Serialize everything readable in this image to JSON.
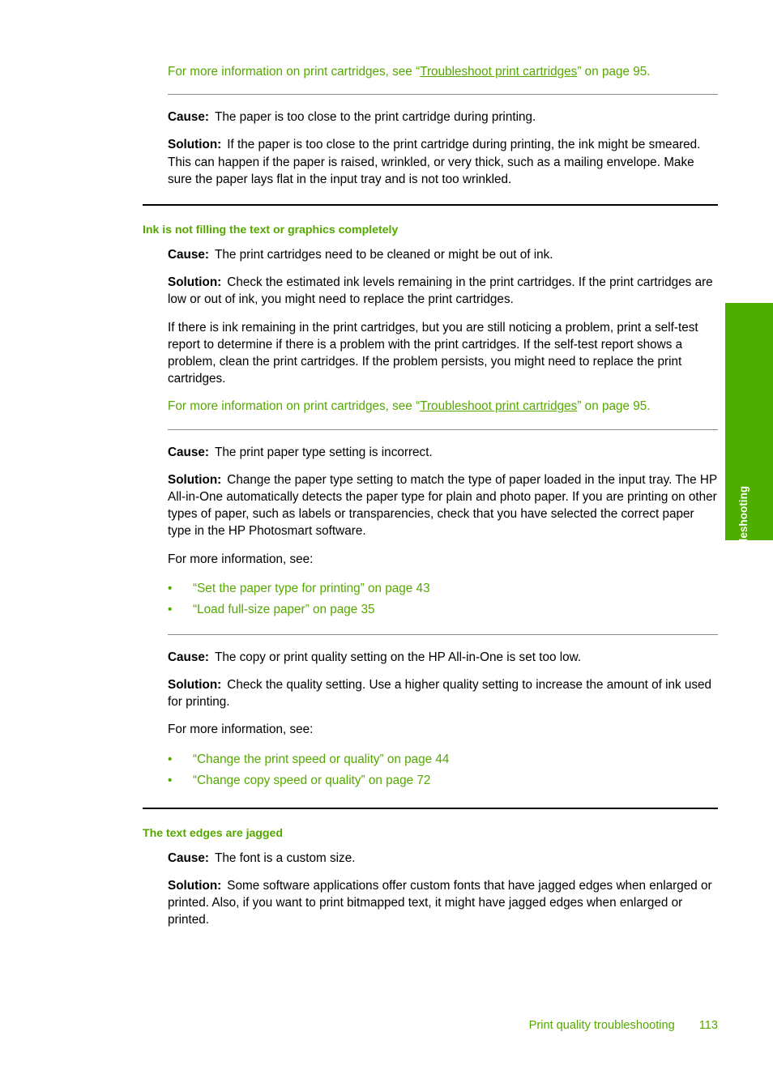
{
  "page": {
    "side_tab_label": "Troubleshooting",
    "footer_title": "Print quality troubleshooting",
    "footer_page_number": "113",
    "accent_green": "#55a800",
    "tab_green": "#4fad00"
  },
  "xref_top": {
    "prefix": "For more information on print cartridges, see ",
    "open_quote": "“",
    "link": "Troubleshoot print cartridges",
    "close_quote": "”",
    "suffix": " on page 95",
    "period": "."
  },
  "block_smear": {
    "cause_label": "Cause:",
    "cause_text": "The paper is too close to the print cartridge during printing.",
    "solution_label": "Solution:",
    "solution_text": "If the paper is too close to the print cartridge during printing, the ink might be smeared. This can happen if the paper is raised, wrinkled, or very thick, such as a mailing envelope. Make sure the paper lays flat in the input tray and is not too wrinkled."
  },
  "section_ink": {
    "heading": "Ink is not filling the text or graphics completely",
    "cause1_label": "Cause:",
    "cause1_text": "The print cartridges need to be cleaned or might be out of ink.",
    "solution1_label": "Solution:",
    "solution1_text": "Check the estimated ink levels remaining in the print cartridges. If the print cartridges are low or out of ink, you might need to replace the print cartridges.",
    "solution1_para2": "If there is ink remaining in the print cartridges, but you are still noticing a problem, print a self-test report to determine if there is a problem with the print cartridges. If the self-test report shows a problem, clean the print cartridges. If the problem persists, you might need to replace the print cartridges.",
    "xref": {
      "prefix": "For more information on print cartridges, see ",
      "open_quote": "“",
      "link": "Troubleshoot print cartridges",
      "close_quote": "”",
      "suffix": " on page 95",
      "period": "."
    },
    "cause2_label": "Cause:",
    "cause2_text": "The print paper type setting is incorrect.",
    "solution2_label": "Solution:",
    "solution2_text": "Change the paper type setting to match the type of paper loaded in the input tray. The HP All-in-One automatically detects the paper type for plain and photo paper. If you are printing on other types of paper, such as labels or transparencies, check that you have selected the correct paper type in the HP Photosmart software.",
    "more_info2": "For more information, see:",
    "bullets2": [
      {
        "bullet": "•",
        "open_quote": "“",
        "link": "Set the paper type for printing",
        "close_quote": "”",
        "suffix": " on page 43"
      },
      {
        "bullet": "•",
        "open_quote": "“",
        "link": "Load full-size paper",
        "close_quote": "”",
        "suffix": " on page 35"
      }
    ],
    "cause3_label": "Cause:",
    "cause3_text": "The copy or print quality setting on the HP All-in-One is set too low.",
    "solution3_label": "Solution:",
    "solution3_text": "Check the quality setting. Use a higher quality setting to increase the amount of ink used for printing.",
    "more_info3": "For more information, see:",
    "bullets3": [
      {
        "bullet": "•",
        "open_quote": "“",
        "link": "Change the print speed or quality",
        "close_quote": "”",
        "suffix": " on page 44"
      },
      {
        "bullet": "•",
        "open_quote": "“",
        "link": "Change copy speed or quality",
        "close_quote": "”",
        "suffix": " on page 72"
      }
    ]
  },
  "section_jagged": {
    "heading": "The text edges are jagged",
    "cause_label": "Cause:",
    "cause_text": "The font is a custom size.",
    "solution_label": "Solution:",
    "solution_text": "Some software applications offer custom fonts that have jagged edges when enlarged or printed. Also, if you want to print bitmapped text, it might have jagged edges when enlarged or printed."
  }
}
